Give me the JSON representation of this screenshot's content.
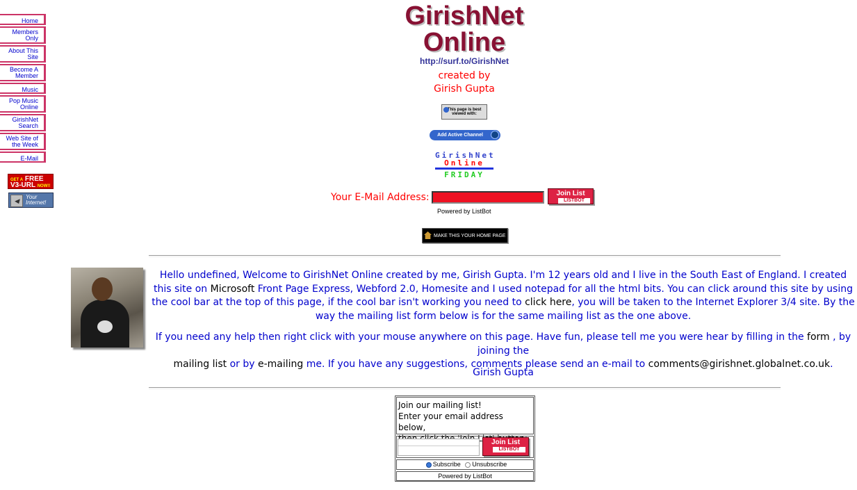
{
  "nav": {
    "items": [
      {
        "label": "Home"
      },
      {
        "label": "Members Only"
      },
      {
        "label": "About This Site"
      },
      {
        "label": "Become A Member"
      },
      {
        "label": "Music"
      },
      {
        "label": "Pop Music Online"
      },
      {
        "label": "GirishNet Search"
      },
      {
        "label": "Web Site of the Week"
      },
      {
        "label": "E-Mail"
      }
    ],
    "badge_free": {
      "top": "GET A",
      "main": "FREE",
      "left": "V3-URL",
      "now": "NOW!!"
    },
    "badge_net": {
      "text1": "Your",
      "text2": "Internet!"
    }
  },
  "header": {
    "logo_line1": "GirishNet",
    "logo_line2": "Online",
    "url": "http://surf.to/GirishNet",
    "created_by": "created by",
    "author": "Girish Gupta",
    "ie_badge": "This page is best viewed with:",
    "channel_button": "Add Active Channel",
    "gn_logo": {
      "line1": "GirishNet",
      "line2": "Online",
      "day": "FRIDAY"
    }
  },
  "subscribe": {
    "label": "Your E-Mail Address:",
    "join_label": "Join List",
    "listbot": "LISTBOT",
    "powered": "Powered by ListBot"
  },
  "homepage_button": "MAKE THIS YOUR HOME PAGE",
  "intro": {
    "p1_a": "Hello undefined, Welcome to GirishNet Online created by me, Girish Gupta. I'm 12 years old and I live in the South East of England. I created this site on",
    "p1_ms": "Microsoft",
    "p1_b": "Front Page Express, Webford 2.0, Homesite and I used notepad for all the html bits. You can click around this site by using the cool bar at the top of this page, if the cool bar isn't working you need to",
    "p1_click": "click here",
    "p1_c": ", you will be taken to the Internet Explorer 3/4 site. By the way the mailing list form below is for the same mailing list as the one above.",
    "p2_a": "If you need any help then right click with your mouse anywhere on this page. Have fun, please tell me you were hear by filling in the",
    "p2_form": "form",
    "p2_b": ", by joining the",
    "p2_mailing": "mailing list",
    "p2_c": "or by",
    "p2_emailing": "e-mailing",
    "p2_d": "me. If you have any suggestions, comments please send an e-mail to",
    "p2_email": "comments@girishnet.globalnet.co.uk",
    "p2_e": ".",
    "signature": "Girish Gupta"
  },
  "listbot_box": {
    "line1": "Join our mailing list!",
    "line2": "Enter your email address below,",
    "line3": "then click the 'Join List' button:",
    "join_label": "Join List",
    "listbot": "LISTBOT",
    "subscribe": "Subscribe",
    "unsubscribe": "Unsubscribe",
    "powered": "Powered by ListBot"
  }
}
